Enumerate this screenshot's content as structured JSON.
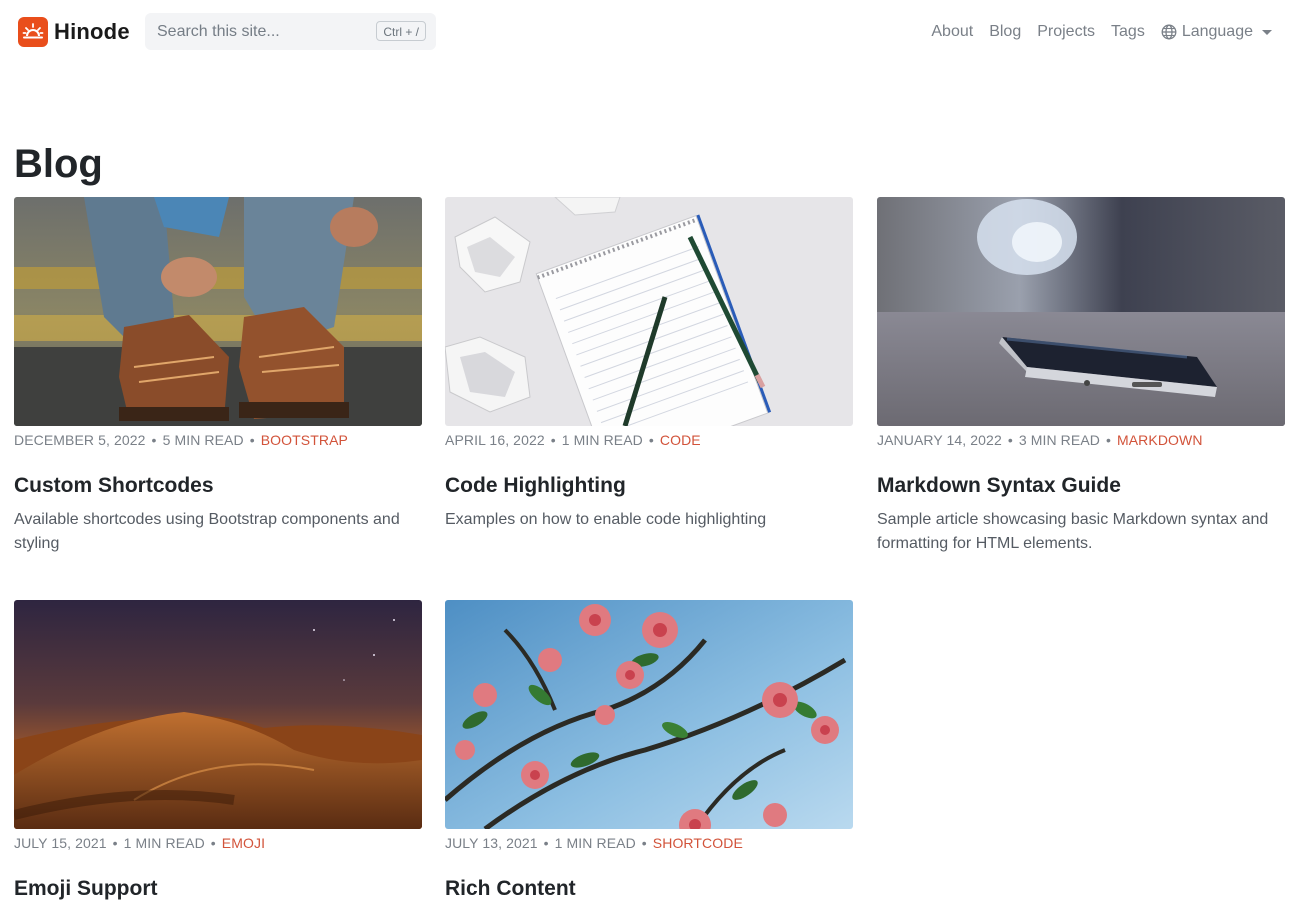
{
  "site": {
    "brand": "Hinode",
    "search": {
      "placeholder": "Search this site...",
      "shortcut": "Ctrl + /"
    },
    "nav": [
      "About",
      "Blog",
      "Projects",
      "Tags"
    ],
    "language_label": "Language"
  },
  "page": {
    "title": "Blog"
  },
  "posts": [
    {
      "date": "DECEMBER 5, 2022",
      "read": "5 MIN READ",
      "tag": "BOOTSTRAP",
      "title": "Custom Shortcodes",
      "desc": "Available shortcodes using Bootstrap components and styling"
    },
    {
      "date": "APRIL 16, 2022",
      "read": "1 MIN READ",
      "tag": "CODE",
      "title": "Code Highlighting",
      "desc": "Examples on how to enable code highlighting"
    },
    {
      "date": "JANUARY 14, 2022",
      "read": "3 MIN READ",
      "tag": "MARKDOWN",
      "title": "Markdown Syntax Guide",
      "desc": "Sample article showcasing basic Markdown syntax and formatting for HTML elements."
    },
    {
      "date": "JULY 15, 2021",
      "read": "1 MIN READ",
      "tag": "EMOJI",
      "title": "Emoji Support",
      "desc": ""
    },
    {
      "date": "JULY 13, 2021",
      "read": "1 MIN READ",
      "tag": "SHORTCODE",
      "title": "Rich Content",
      "desc": ""
    }
  ],
  "meta_separator": "•",
  "colors": {
    "brand": "#e94e1b",
    "tag": "#d2533a",
    "muted": "#7a8088"
  },
  "icons": {
    "logo": "sunrise-icon",
    "language": "globe-icon",
    "dropdown": "caret-down-icon"
  }
}
